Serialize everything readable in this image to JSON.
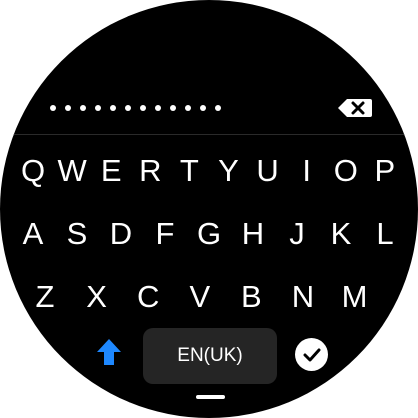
{
  "password_field": {
    "masked_length": 12
  },
  "icons": {
    "backspace": "backspace-icon",
    "shift": "shift-up-arrow-icon",
    "done": "checkmark-icon"
  },
  "keyboard": {
    "row1": [
      "Q",
      "W",
      "E",
      "R",
      "T",
      "Y",
      "U",
      "I",
      "O",
      "P"
    ],
    "row2": [
      "A",
      "S",
      "D",
      "F",
      "G",
      "H",
      "J",
      "K",
      "L"
    ],
    "row3": [
      "Z",
      "X",
      "C",
      "V",
      "B",
      "N",
      "M"
    ]
  },
  "language_label": "EN(UK)",
  "colors": {
    "background": "#000000",
    "key_text": "#ffffff",
    "shift_accent": "#1e88ff",
    "language_button_bg": "#252525"
  }
}
